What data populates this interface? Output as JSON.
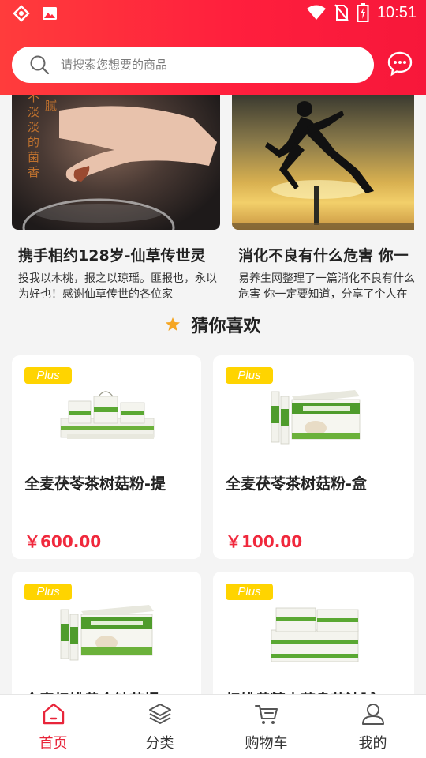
{
  "status_bar": {
    "time": "10:51"
  },
  "search": {
    "placeholder": "请搜索您想要的商品"
  },
  "articles": [
    {
      "title": "携手相约128岁-仙草传世灵",
      "desc": "投我以木桃，报之以琼瑶。匪报也，永以为好也！感谢仙草传世的各位家",
      "image_text": [
        "不",
        "腻",
        "淡",
        "淡",
        "的",
        "菌",
        "香"
      ]
    },
    {
      "title": "消化不良有什么危害 你一",
      "desc": "易养生网整理了一篇消化不良有什么危害 你一定要知道，分享了个人在"
    }
  ],
  "section": {
    "title": "猜你喜欢"
  },
  "products": [
    {
      "badge": "Plus",
      "name": "全麦茯苓茶树菇粉-提",
      "price": "￥600.00"
    },
    {
      "badge": "Plus",
      "name": "全麦茯苓茶树菇粉-盒",
      "price": "￥100.00"
    },
    {
      "badge": "Plus",
      "name": "全麦杞姚黄金钛苗提",
      "price": ""
    },
    {
      "badge": "Plus",
      "name": "杞姚黄精山药鼻苗油腻",
      "price": ""
    }
  ],
  "tabs": [
    {
      "label": "首页",
      "icon": "home-icon",
      "active": true
    },
    {
      "label": "分类",
      "icon": "layers-icon",
      "active": false
    },
    {
      "label": "购物车",
      "icon": "cart-icon",
      "active": false
    },
    {
      "label": "我的",
      "icon": "user-icon",
      "active": false
    }
  ],
  "colors": {
    "brand_red": "#ff1f3d",
    "price_red": "#f0283c",
    "plus_yellow": "#ffd400",
    "star_orange": "#f5a623"
  }
}
